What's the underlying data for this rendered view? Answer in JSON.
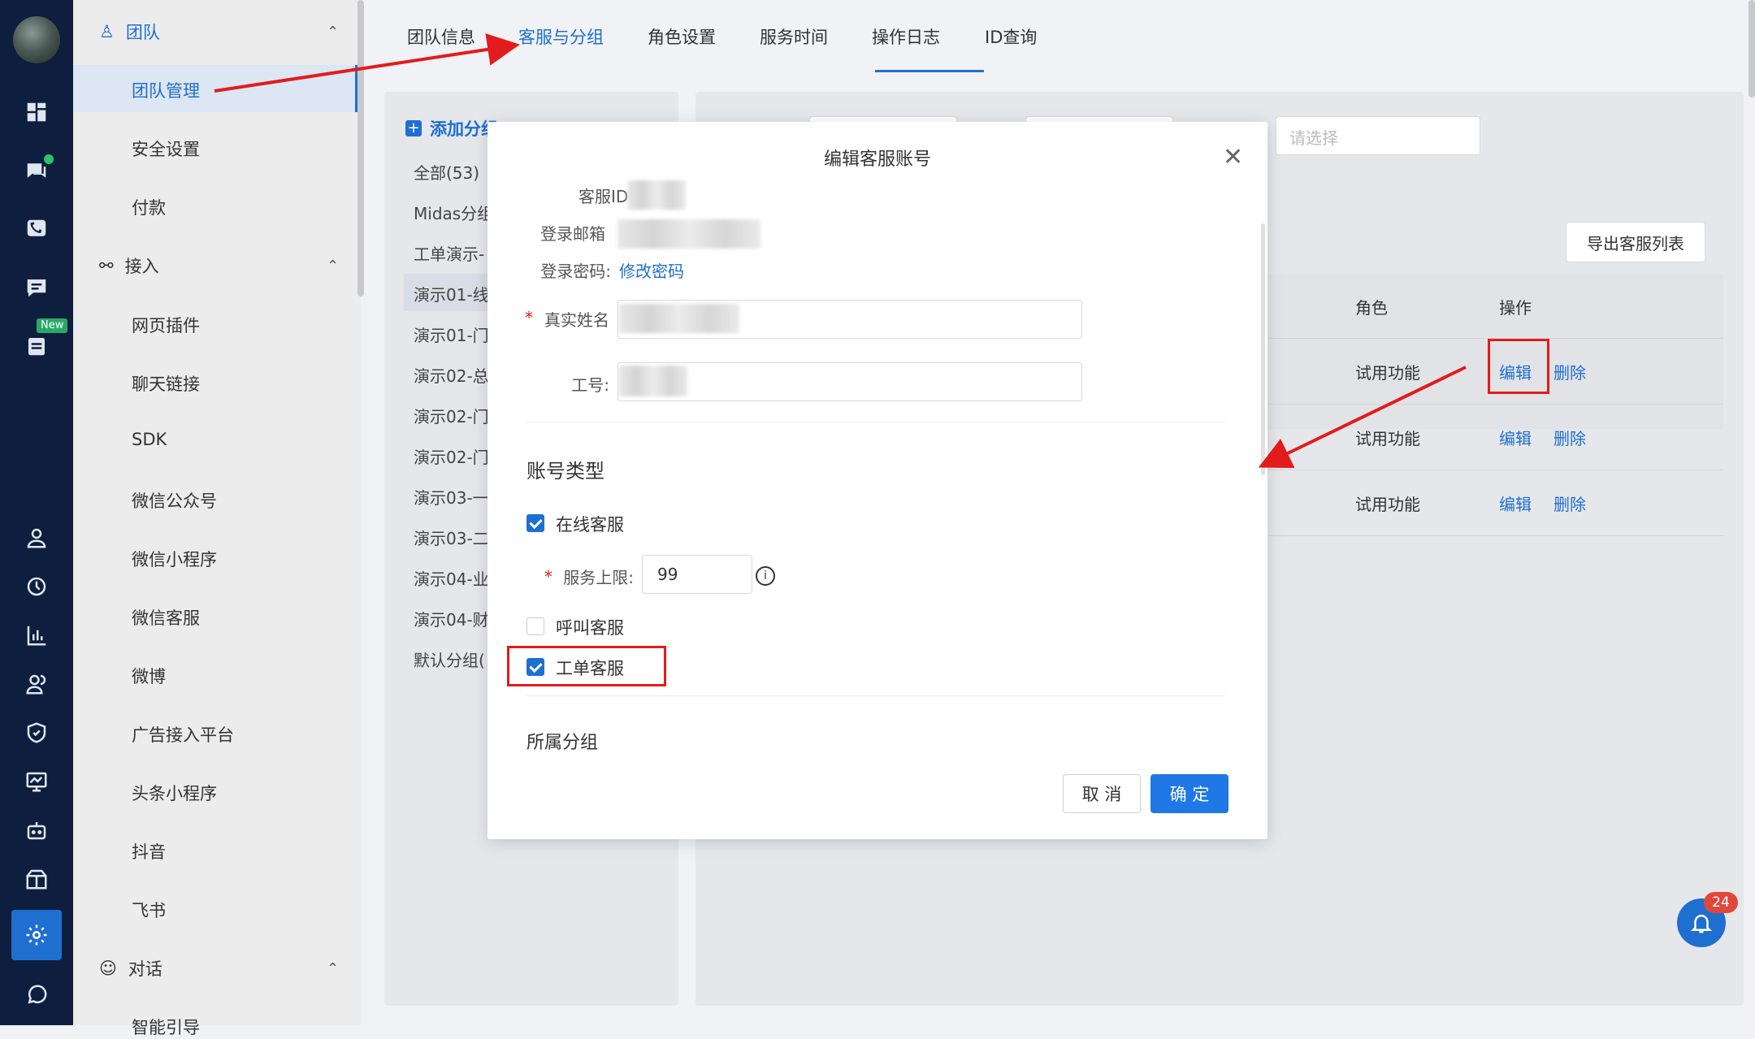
{
  "rail": {
    "icons": [
      "dashboard-icon",
      "chat-icon",
      "phone-icon",
      "message-icon",
      "ticket-icon",
      "user-icon",
      "history-icon",
      "chart-icon",
      "team-icon",
      "shield-icon",
      "monitor-icon",
      "robot-icon",
      "package-icon",
      "settings-icon",
      "whatsapp-icon"
    ],
    "new_badge": "New"
  },
  "menu": {
    "group_team": "团队",
    "items_team": [
      "团队管理",
      "安全设置",
      "付款"
    ],
    "group_access": "接入",
    "items_access": [
      "网页插件",
      "聊天链接",
      "SDK",
      "微信公众号",
      "微信小程序",
      "微信客服",
      "微博",
      "广告接入平台",
      "头条小程序",
      "抖音",
      "飞书"
    ],
    "group_dialog": "对话",
    "items_dialog": [
      "智能引导"
    ]
  },
  "tabs": [
    "团队信息",
    "客服与分组",
    "角色设置",
    "服务时间",
    "操作日志",
    "ID查询"
  ],
  "groups": {
    "add_label": "添加分组",
    "items": [
      "全部(53)",
      "Midas分组",
      "工单演示-",
      "演示01-线",
      "演示01-门",
      "演示02-总",
      "演示02-门",
      "演示02-门",
      "演示03-一",
      "演示03-二",
      "演示04-业",
      "演示04-财",
      "默认分组("
    ]
  },
  "main": {
    "select_placeholder": "请选择",
    "export_button": "导出客服列表",
    "col_role": "角色",
    "col_action": "操作",
    "rows": [
      {
        "role": "试用功能",
        "edit": "编辑",
        "delete": "删除"
      },
      {
        "role": "试用功能",
        "edit": "编辑",
        "delete": "删除"
      },
      {
        "role": "试用功能",
        "edit": "编辑",
        "delete": "删除"
      }
    ]
  },
  "modal": {
    "title": "编辑客服账号",
    "label_id": "客服ID:",
    "label_email": "登录邮箱",
    "label_password": "登录密码:",
    "change_password": "修改密码",
    "label_realname": "真实姓名",
    "label_workno": "工号:",
    "section_type": "账号类型",
    "online_service": "在线客服",
    "online_checked": true,
    "label_limit": "服务上限:",
    "limit_value": "99",
    "call_service": "呼叫客服",
    "call_checked": false,
    "ticket_service": "工单客服",
    "ticket_checked": true,
    "section_group": "所属分组",
    "cancel": "取 消",
    "confirm": "确 定"
  },
  "notifications": {
    "count": "24"
  },
  "colors": {
    "accent": "#1f6fd1",
    "rail": "#0e1e3e",
    "annotation": "#e21c1c"
  }
}
